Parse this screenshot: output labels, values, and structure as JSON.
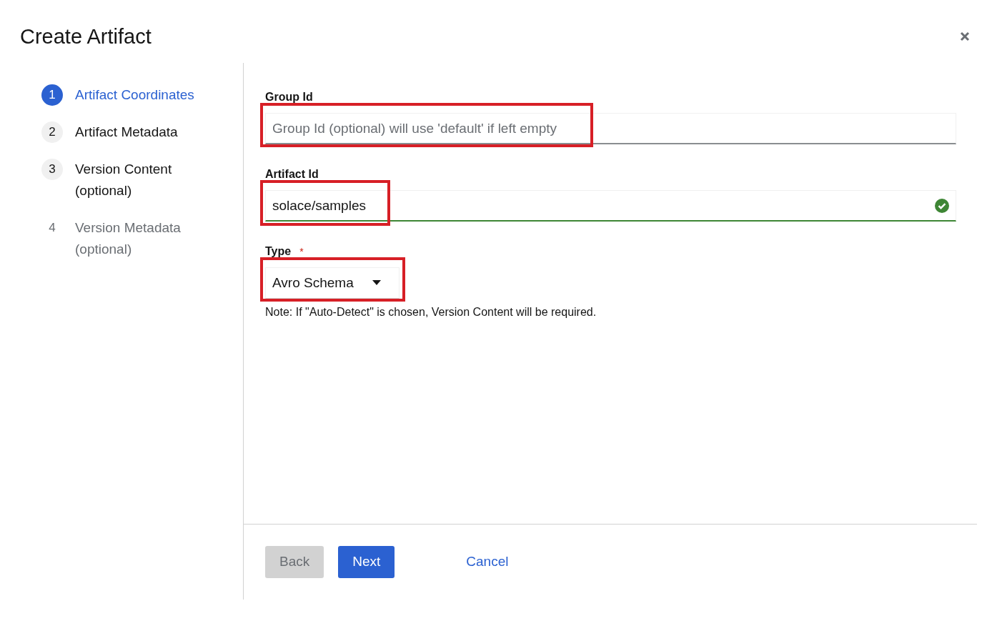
{
  "dialog": {
    "title": "Create Artifact"
  },
  "steps": [
    {
      "number": "1",
      "label": "Artifact Coordinates",
      "selected": true,
      "disabled": false
    },
    {
      "number": "2",
      "label": "Artifact Metadata",
      "selected": false,
      "disabled": false
    },
    {
      "number": "3",
      "label": "Version Content (optional)",
      "selected": false,
      "disabled": false
    },
    {
      "number": "4",
      "label": "Version Metadata (optional)",
      "selected": false,
      "disabled": true
    }
  ],
  "fields": [
    {
      "kind": "text",
      "label": "Group Id",
      "placeholder": "Group Id (optional) will use 'default' if left empty",
      "valid": false,
      "highlighted": true
    },
    {
      "kind": "text",
      "label": "Artifact Id",
      "value": "solace/samples",
      "valid": true,
      "highlighted": true
    },
    {
      "kind": "select",
      "label": "Type",
      "required_mark": "*",
      "value": "Avro Schema",
      "highlighted": true,
      "helper": "Note: If \"Auto-Detect\" is chosen, Version Content will be required."
    }
  ],
  "buttons": [
    {
      "kind": "secondary",
      "label": "Back",
      "disabled": true
    },
    {
      "kind": "primary",
      "label": "Next",
      "disabled": false
    },
    {
      "kind": "link",
      "label": "Cancel",
      "disabled": false
    }
  ]
}
